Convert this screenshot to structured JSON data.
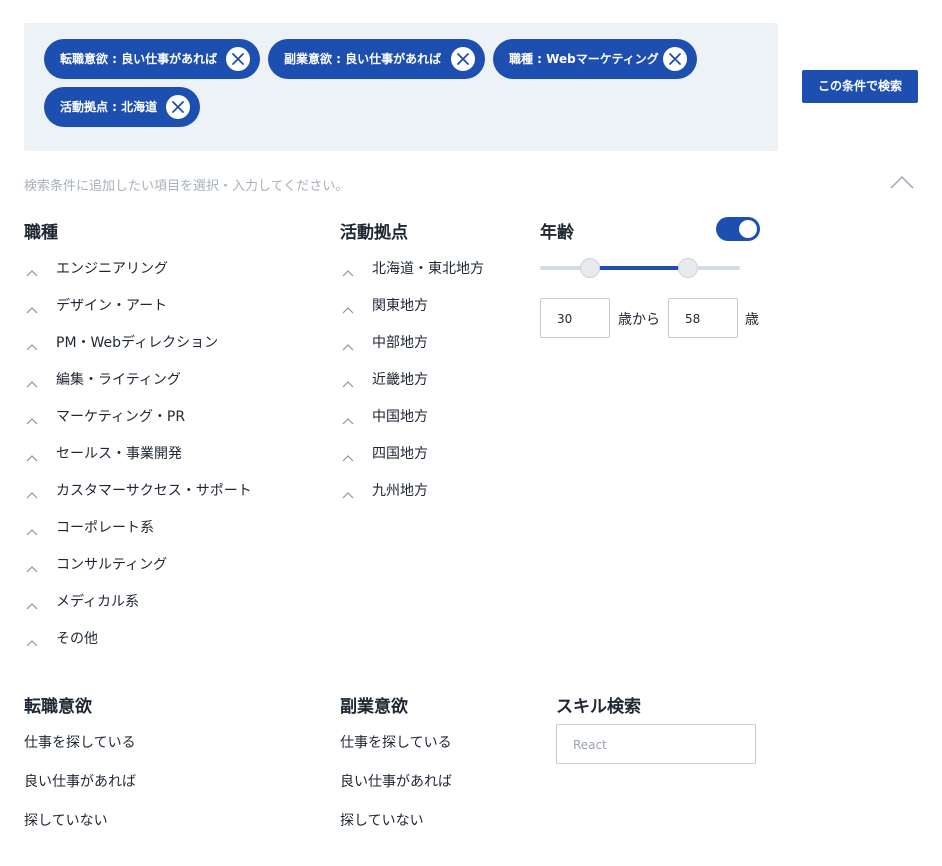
{
  "chips": [
    {
      "label": "転職意欲 : 良い仕事があれば"
    },
    {
      "label": "副業意欲 : 良い仕事があれば"
    },
    {
      "label": "職種 : Webマーケティング"
    },
    {
      "label": "活動拠点 : 北海道"
    }
  ],
  "search_button": "この条件で検索",
  "hint": "検索条件に追加したい項目を選択・入力してください。",
  "job_type": {
    "title": "職種",
    "items": [
      "エンジニアリング",
      "デザイン・アート",
      "PM・Webディレクション",
      "編集・ライティング",
      "マーケティング・PR",
      "セールス・事業開発",
      "カスタマーサクセス・サポート",
      "コーポレート系",
      "コンサルティング",
      "メディカル系",
      "その他"
    ]
  },
  "location": {
    "title": "活動拠点",
    "items": [
      "北海道・東北地方",
      "関東地方",
      "中部地方",
      "近畿地方",
      "中国地方",
      "四国地方",
      "九州地方"
    ]
  },
  "age": {
    "title": "年齢",
    "toggle_on": true,
    "from": "30",
    "to": "58",
    "from_unit": "歳から",
    "to_unit": "歳",
    "range_fraction": [
      0.25,
      0.74
    ]
  },
  "job_change": {
    "title": "転職意欲",
    "items": [
      "仕事を探している",
      "良い仕事があれば",
      "探していない"
    ]
  },
  "side_job": {
    "title": "副業意欲",
    "items": [
      "仕事を探している",
      "良い仕事があれば",
      "探していない"
    ]
  },
  "skill": {
    "title": "スキル検索",
    "placeholder": "React"
  },
  "colors": {
    "accent": "#1d4fb1",
    "panel": "#edf2f7",
    "hint": "#a8b0ba"
  }
}
